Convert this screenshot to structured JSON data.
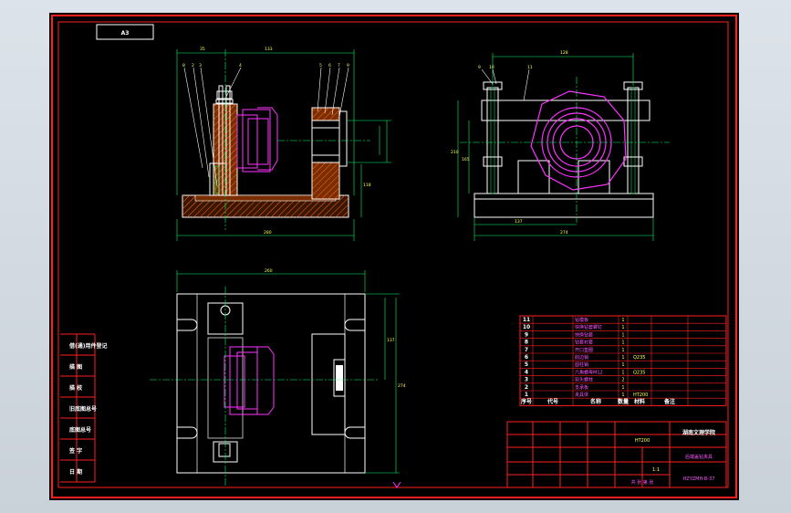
{
  "drawing": {
    "corner_tag": "A3",
    "title_block": {
      "institution": "湖南文理学院",
      "part_name": "后端盖钻夹具",
      "drawing_no": "HZYZMH-B-37",
      "material": "HT200",
      "ratio": "1:1",
      "sheet_info": "共 张 第 张"
    },
    "left_column_labels": [
      "借(通)用件登记",
      "描 图",
      "描 校",
      "旧底图总号",
      "底图总号",
      "签 字",
      "日 期"
    ],
    "parts_list": {
      "headers": [
        "序号",
        "代号",
        "名称",
        "数量",
        "材料",
        "备注"
      ],
      "rows": [
        {
          "no": "11",
          "name": "钻模板",
          "qty": "1",
          "mat": ""
        },
        {
          "no": "10",
          "name": "快换钻套螺钉",
          "qty": "1",
          "mat": ""
        },
        {
          "no": "9",
          "name": "快换钻套",
          "qty": "1",
          "mat": ""
        },
        {
          "no": "8",
          "name": "钻套衬套",
          "qty": "1",
          "mat": ""
        },
        {
          "no": "7",
          "name": "开口垫圈",
          "qty": "1",
          "mat": ""
        },
        {
          "no": "6",
          "name": "削边销",
          "qty": "1",
          "mat": "Q235"
        },
        {
          "no": "5",
          "name": "圆柱销",
          "qty": "1",
          "mat": ""
        },
        {
          "no": "4",
          "name": "六角螺母M12",
          "qty": "1",
          "mat": "Q235"
        },
        {
          "no": "3",
          "name": "双头螺柱",
          "qty": "2",
          "mat": ""
        },
        {
          "no": "2",
          "name": "支承板",
          "qty": "1",
          "mat": ""
        },
        {
          "no": "1",
          "name": "夹具体",
          "qty": "1",
          "mat": "HT200"
        }
      ]
    },
    "dimensions": {
      "front_top_a": "35",
      "front_top_b": "133",
      "front_bottom": "280",
      "front_height": "118",
      "side_top": "128",
      "side_height_a": "210",
      "side_height_b": "165",
      "side_base_a": "137",
      "side_base_b": "274",
      "plan_width": "260",
      "plan_height_a": "137",
      "plan_height_b": "274"
    },
    "balloons_front_left": [
      "8",
      "2",
      "3",
      "4"
    ],
    "balloons_front_right": [
      "5",
      "6",
      "7",
      "9"
    ],
    "balloons_side": [
      "9",
      "10",
      "11"
    ]
  }
}
